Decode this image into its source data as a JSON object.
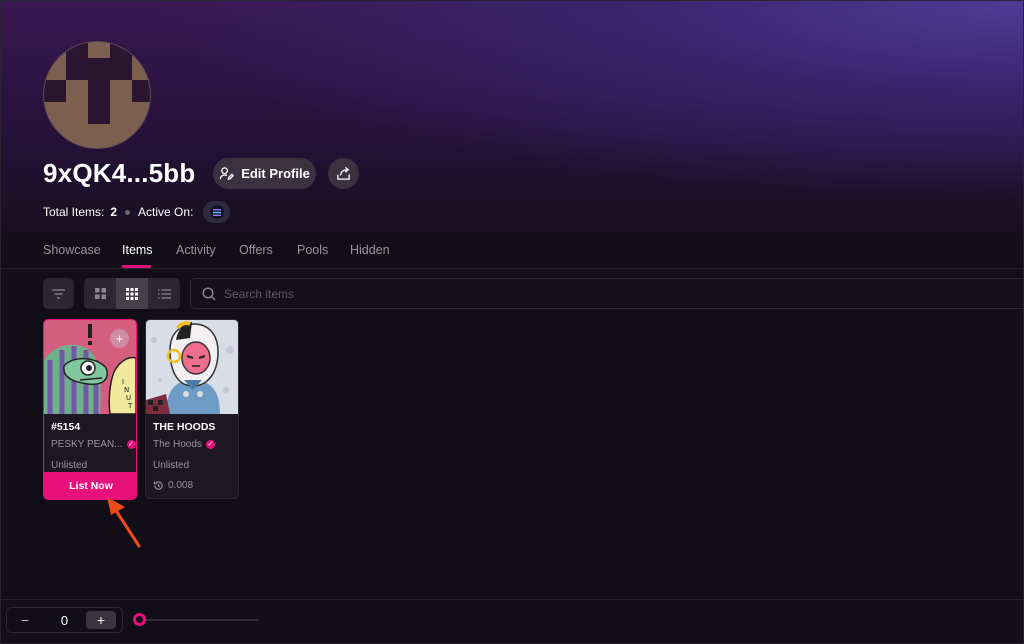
{
  "profile": {
    "name": "9xQK4...5bb",
    "edit_label": "Edit Profile",
    "total_items_label": "Total Items:",
    "total_items_value": "2",
    "active_on_label": "Active On:"
  },
  "tabs": [
    {
      "label": "Showcase"
    },
    {
      "label": "Items",
      "active": true
    },
    {
      "label": "Activity"
    },
    {
      "label": "Offers"
    },
    {
      "label": "Pools"
    },
    {
      "label": "Hidden"
    }
  ],
  "toolbar": {
    "search_placeholder": "Search items",
    "active_view": "grid-compact"
  },
  "cards": [
    {
      "title": "#5154",
      "collection": "PESKY PEAN...",
      "status": "Unlisted",
      "action": "List Now"
    },
    {
      "title": "THE HOODS",
      "collection": "The Hoods",
      "status": "Unlisted",
      "price": "0.008"
    }
  ],
  "bottom": {
    "minus": "−",
    "stepper_value": "0",
    "plus": "+",
    "slider_value": 0
  },
  "colors": {
    "accent": "#e8117b",
    "background": "#120e18"
  }
}
